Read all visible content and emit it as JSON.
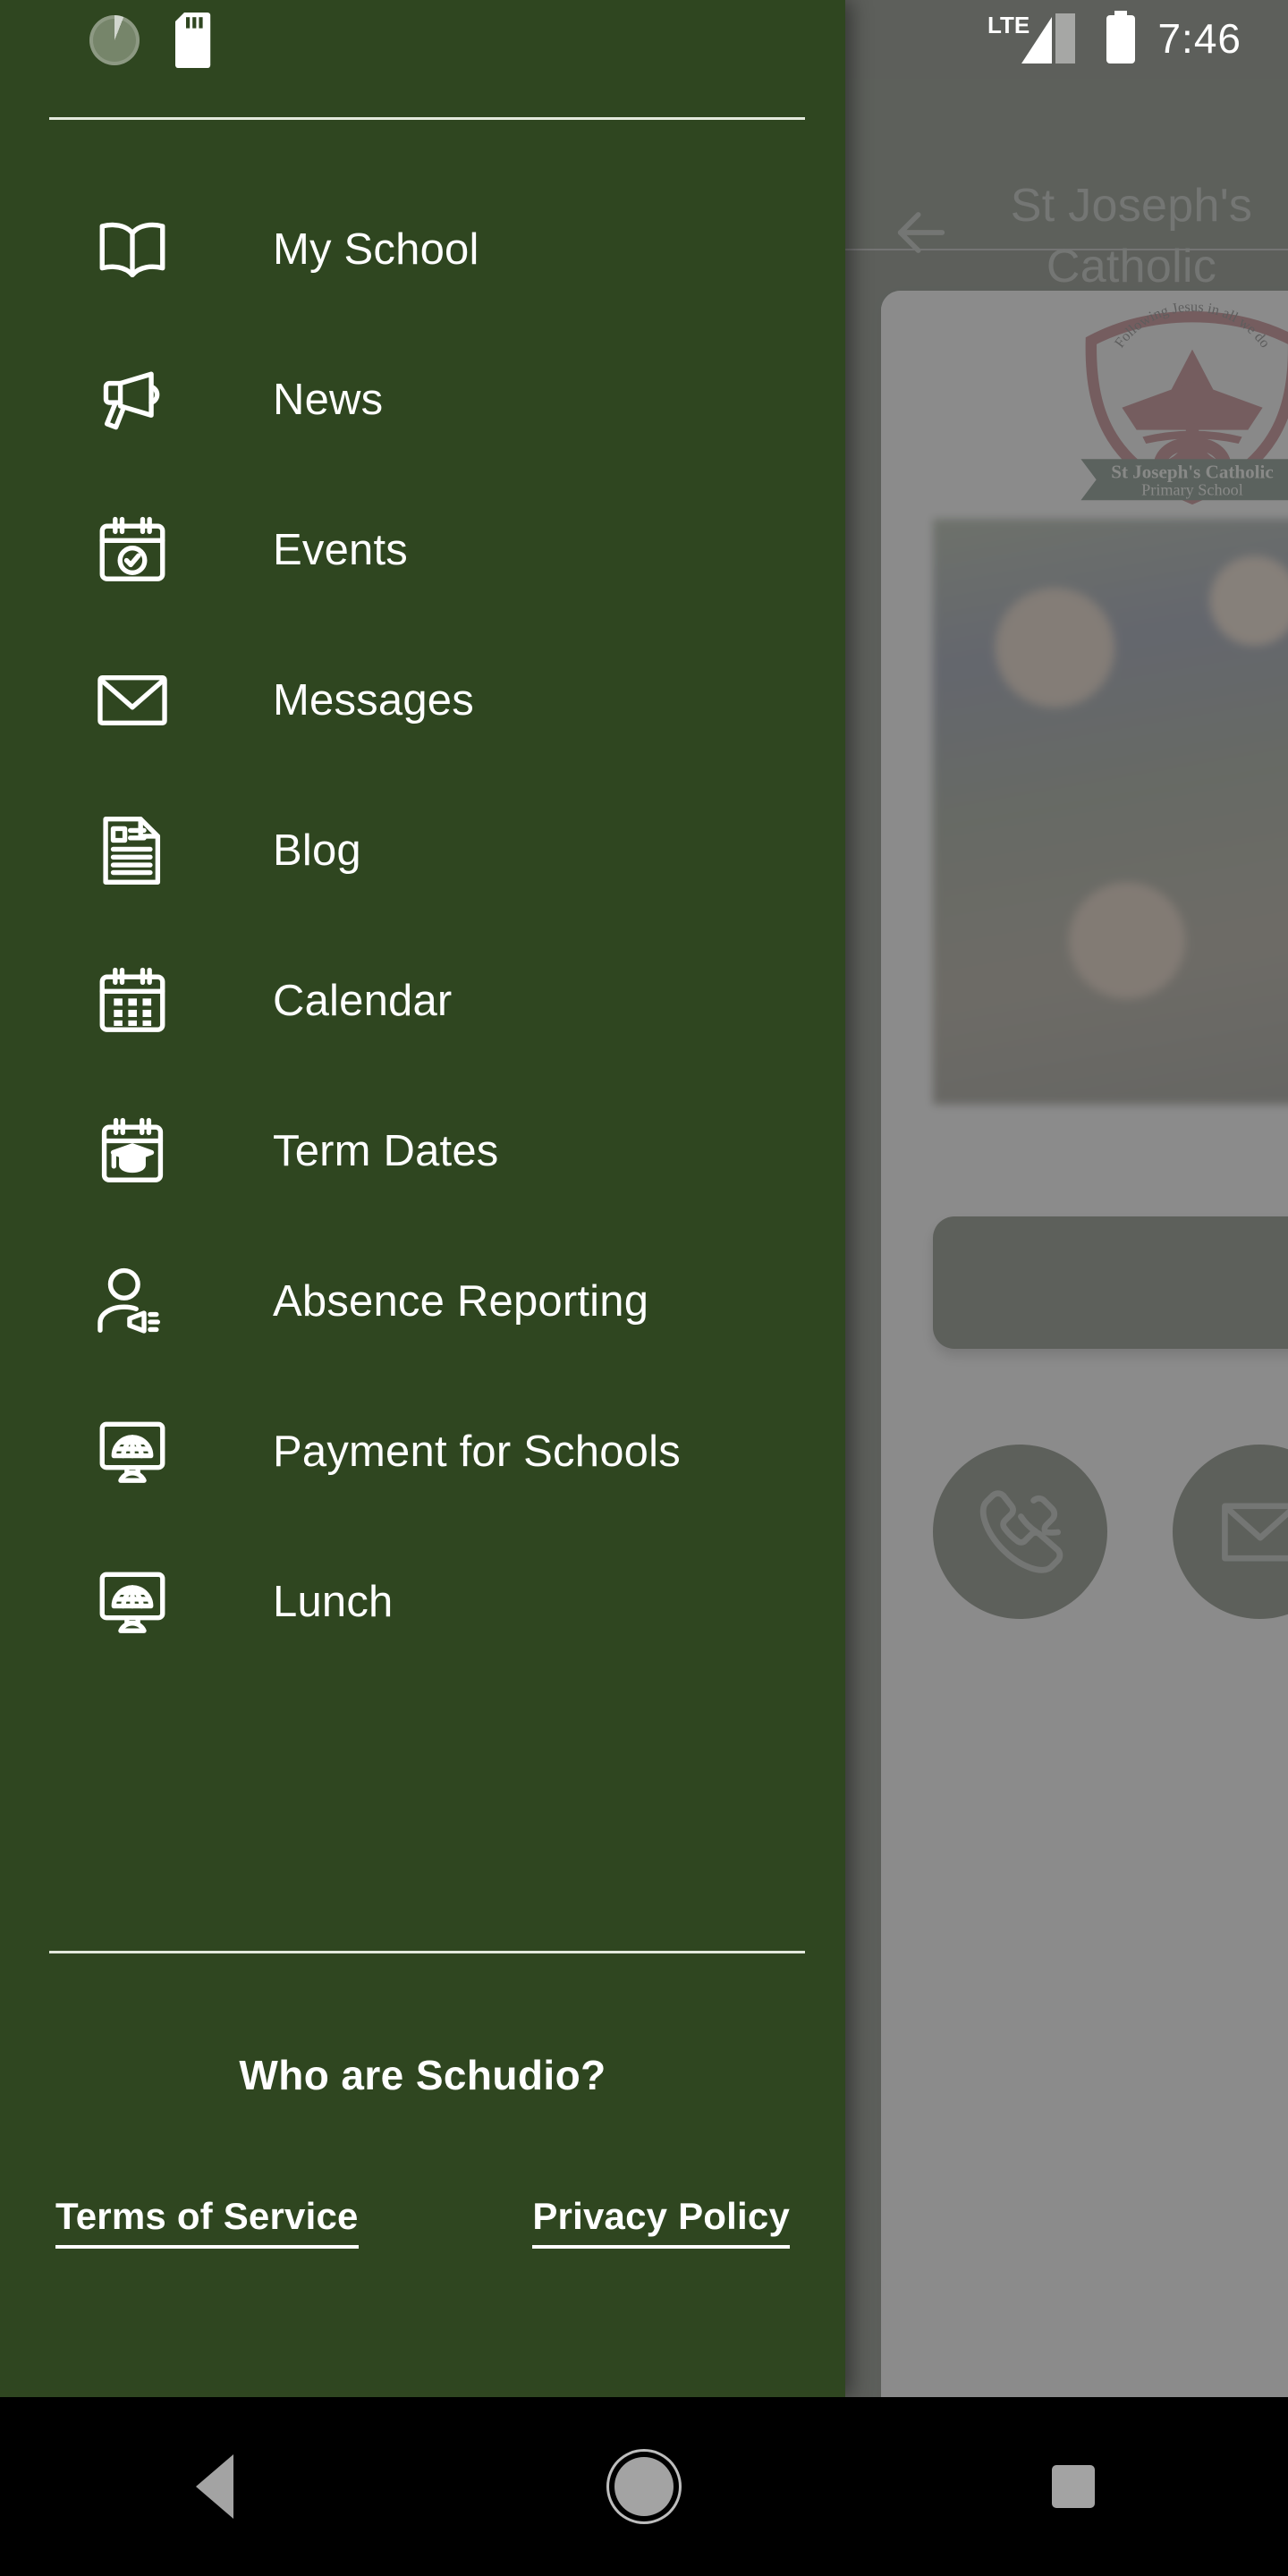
{
  "status_bar": {
    "time": "7:46",
    "network_label": "LTE",
    "icons": [
      "sync-spinner-icon",
      "sd-card-icon",
      "lte-signal-icon",
      "battery-icon"
    ]
  },
  "app_bar": {
    "back_label": "back-arrow",
    "title": "St Joseph's Catholic\nSchool"
  },
  "background_content": {
    "crest": {
      "motto": "Following Jesus in all we do",
      "name_line1": "St Joseph's Catholic",
      "name_line2": "Primary School"
    },
    "contact_buttons": [
      {
        "name": "phone-button",
        "icon": "phone-icon"
      },
      {
        "name": "email-button",
        "icon": "envelope-icon"
      }
    ]
  },
  "drawer": {
    "items": [
      {
        "label": "My School",
        "icon": "open-book-icon"
      },
      {
        "label": "News",
        "icon": "megaphone-icon"
      },
      {
        "label": "Events",
        "icon": "calendar-check-icon"
      },
      {
        "label": "Messages",
        "icon": "envelope-icon"
      },
      {
        "label": "Blog",
        "icon": "article-document-icon"
      },
      {
        "label": "Calendar",
        "icon": "calendar-grid-icon"
      },
      {
        "label": "Term Dates",
        "icon": "calendar-graduation-icon"
      },
      {
        "label": "Absence Reporting",
        "icon": "person-megaphone-icon"
      },
      {
        "label": "Payment for Schools",
        "icon": "monitor-globe-icon"
      },
      {
        "label": "Lunch",
        "icon": "monitor-globe-icon"
      }
    ],
    "footer": {
      "who_are_schudio": "Who are Schudio?",
      "terms_of_service": "Terms of Service",
      "privacy_policy": "Privacy Policy"
    }
  },
  "nav_bar": {
    "back": "back-triangle",
    "home": "home-circle",
    "recents": "recents-square"
  },
  "colors": {
    "drawer_green": "#2f4620",
    "dark_green": "#1c2a12",
    "crest_red": "#8f1d26",
    "crest_banner_green": "#13331f",
    "text_white": "#ffffff",
    "scrim": "rgba(110,110,110,0.80)"
  }
}
